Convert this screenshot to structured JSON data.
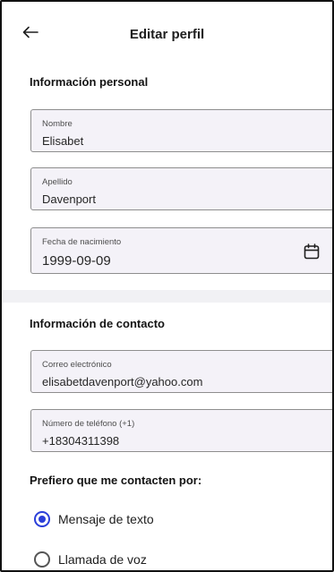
{
  "header": {
    "title": "Editar perfil",
    "back_icon": "arrow-left-icon"
  },
  "personal": {
    "section_title": "Información personal",
    "first_name": {
      "label": "Nombre",
      "value": "Elisabet"
    },
    "last_name": {
      "label": "Apellido",
      "value": "Davenport"
    },
    "birth_date": {
      "label": "Fecha de nacimiento",
      "value": "1999-09-09",
      "icon": "calendar-icon"
    }
  },
  "contact": {
    "section_title": "Información de contacto",
    "email": {
      "label": "Correo electrónico",
      "value": "elisabetdavenport@yahoo.com"
    },
    "phone": {
      "label": "Número de teléfono (+1)",
      "value": "+18304311398"
    }
  },
  "preference": {
    "title": "Prefiero que me contacten por:",
    "options": [
      {
        "label": "Mensaje de texto",
        "selected": true
      },
      {
        "label": "Llamada de voz",
        "selected": false
      }
    ]
  },
  "colors": {
    "accent": "#2b3fd9",
    "field_bg": "#f4f2f8",
    "field_border": "#8e8e8e"
  }
}
